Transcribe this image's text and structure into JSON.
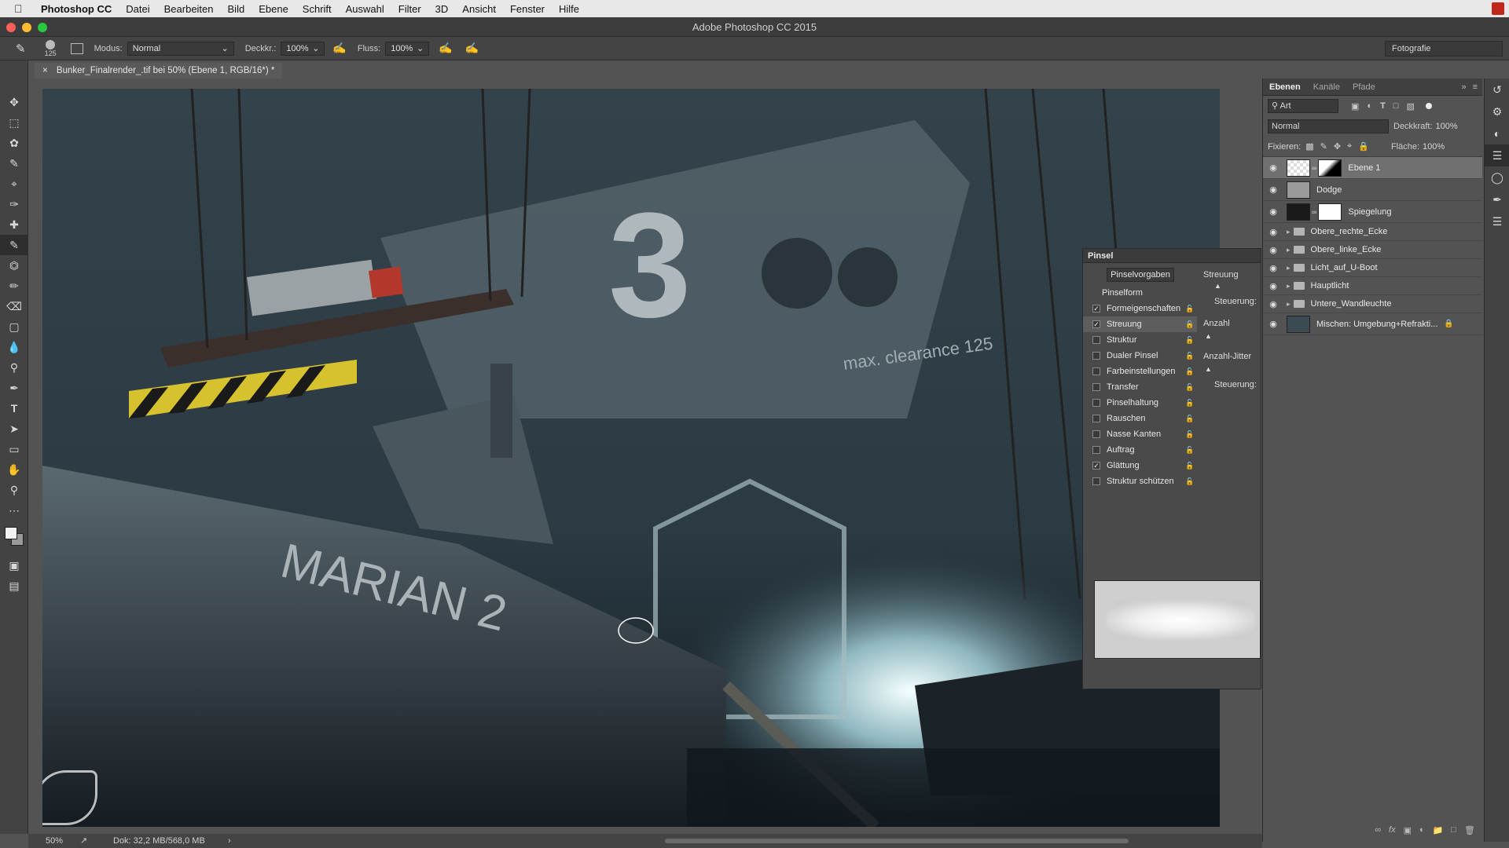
{
  "menubar": {
    "app_name": "Photoshop CC",
    "items": [
      "Datei",
      "Bearbeiten",
      "Bild",
      "Ebene",
      "Schrift",
      "Auswahl",
      "Filter",
      "3D",
      "Ansicht",
      "Fenster",
      "Hilfe"
    ]
  },
  "window": {
    "title": "Adobe Photoshop CC 2015"
  },
  "options": {
    "brush_size": "125",
    "modus_label": "Modus:",
    "modus_value": "Normal",
    "deckkr_label": "Deckkr.:",
    "deckkr_value": "100%",
    "fluss_label": "Fluss:",
    "fluss_value": "100%",
    "workspace": "Fotografie"
  },
  "document": {
    "tab_title": "Bunker_Finalrender_.tif bei 50% (Ebene 1, RGB/16*) *"
  },
  "status": {
    "zoom": "50%",
    "doc_info": "Dok: 32,2 MB/568,0 MB"
  },
  "layers_panel": {
    "tabs": [
      "Ebenen",
      "Kanäle",
      "Pfade"
    ],
    "filter": "Art",
    "blend": "Normal",
    "opacity_label": "Deckkraft:",
    "opacity": "100%",
    "lock_label": "Fixieren:",
    "fill_label": "Fläche:",
    "fill": "100%",
    "layers": [
      {
        "name": "Ebene 1",
        "type": "layer"
      },
      {
        "name": "Dodge",
        "type": "layer"
      },
      {
        "name": "Spiegelung",
        "type": "layer"
      },
      {
        "name": "Obere_rechte_Ecke",
        "type": "group"
      },
      {
        "name": "Obere_linke_Ecke",
        "type": "group"
      },
      {
        "name": "Licht_auf_U-Boot",
        "type": "group"
      },
      {
        "name": "Hauptlicht",
        "type": "group"
      },
      {
        "name": "Untere_Wandleuchte",
        "type": "group"
      },
      {
        "name": "Mischen: Umgebung+Refrakti...",
        "type": "layer"
      }
    ]
  },
  "brush_panel": {
    "title": "Pinsel",
    "presets_button": "Pinselvorgaben",
    "section": "Pinselform",
    "streuung_label": "Streuung",
    "steuerung_label": "Steuerung:",
    "anzahl_label": "Anzahl",
    "anzahl_jitter_label": "Anzahl-Jitter",
    "options": [
      {
        "label": "Formeigenschaften",
        "checked": true
      },
      {
        "label": "Streuung",
        "checked": true
      },
      {
        "label": "Struktur",
        "checked": false
      },
      {
        "label": "Dualer Pinsel",
        "checked": false
      },
      {
        "label": "Farbeinstellungen",
        "checked": false
      },
      {
        "label": "Transfer",
        "checked": false
      },
      {
        "label": "Pinselhaltung",
        "checked": false
      },
      {
        "label": "Rauschen",
        "checked": false
      },
      {
        "label": "Nasse Kanten",
        "checked": false
      },
      {
        "label": "Auftrag",
        "checked": false
      },
      {
        "label": "Glättung",
        "checked": true
      },
      {
        "label": "Struktur schützen",
        "checked": false
      }
    ]
  },
  "canvas_text": {
    "hull_name": "MARIAN 2",
    "tunnel_number": "3",
    "clearance": "max. clearance 125"
  }
}
